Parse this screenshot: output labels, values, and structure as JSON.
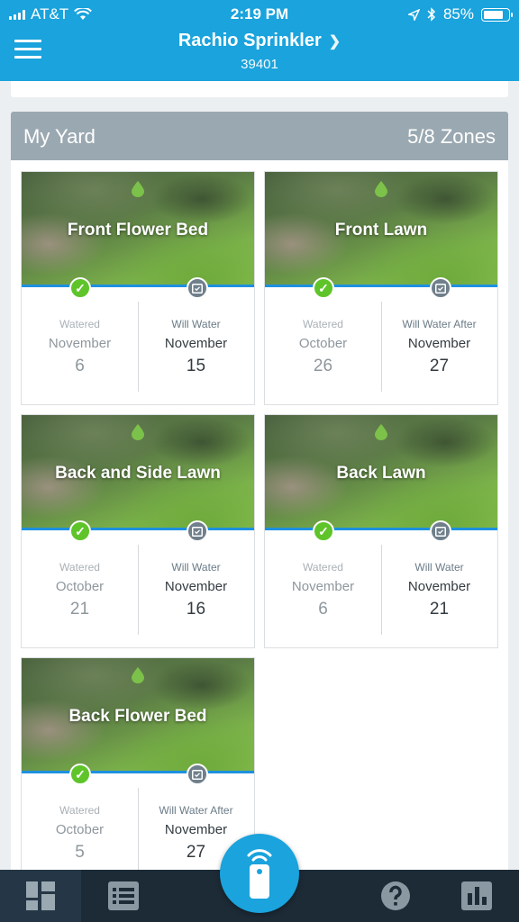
{
  "status": {
    "carrier": "AT&T",
    "time": "2:19 PM",
    "battery_percent": "85%",
    "battery_level": 0.85
  },
  "header": {
    "title": "Rachio Sprinkler",
    "subtitle": "39401"
  },
  "section": {
    "name": "My Yard",
    "count": "5/8 Zones"
  },
  "zones": [
    {
      "name": "Front Flower Bed",
      "watered_label": "Watered",
      "watered_month": "November",
      "watered_day": "6",
      "next_label": "Will Water",
      "next_month": "November",
      "next_day": "15"
    },
    {
      "name": "Front Lawn",
      "watered_label": "Watered",
      "watered_month": "October",
      "watered_day": "26",
      "next_label": "Will Water After",
      "next_month": "November",
      "next_day": "27"
    },
    {
      "name": "Back and Side Lawn",
      "watered_label": "Watered",
      "watered_month": "October",
      "watered_day": "21",
      "next_label": "Will Water",
      "next_month": "November",
      "next_day": "16"
    },
    {
      "name": "Back Lawn",
      "watered_label": "Watered",
      "watered_month": "November",
      "watered_day": "6",
      "next_label": "Will Water",
      "next_month": "November",
      "next_day": "21"
    },
    {
      "name": "Back Flower Bed",
      "watered_label": "Watered",
      "watered_month": "October",
      "watered_day": "5",
      "next_label": "Will Water After",
      "next_month": "November",
      "next_day": "27"
    }
  ],
  "colors": {
    "brand": "#1aa3dc",
    "nav_bg": "#1d2b37",
    "watered_check": "#5ec42a",
    "section_header": "#9aa8b1",
    "drop": "#7cc24a"
  },
  "icons": {
    "menu": "hamburger-icon",
    "drop": "water-drop-icon",
    "check": "checkmark-icon",
    "calendar": "calendar-icon",
    "dashboard": "dashboard-icon",
    "list": "list-icon",
    "remote": "remote-control-icon",
    "help": "help-icon",
    "stats": "bar-chart-icon"
  }
}
